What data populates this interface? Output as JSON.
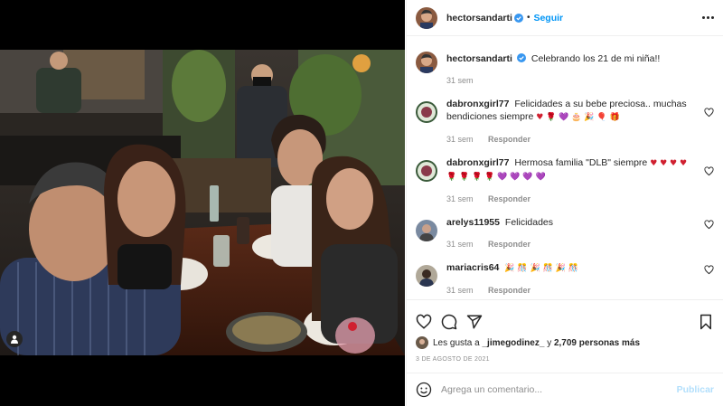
{
  "post": {
    "author": "hectorsandarti",
    "follow_label": "Seguir",
    "separator": "•",
    "caption": "Celebrando los 21 de mi niña!!",
    "caption_time": "31 sem"
  },
  "comments": [
    {
      "user": "dabronxgirl77",
      "text": "Felicidades a su bebe preciosa.. muchas bendiciones siempre",
      "emojis": "♥ 🌹 💜 🎂 🎉 🎈 🎁",
      "time": "31 sem",
      "reply_label": "Responder"
    },
    {
      "user": "dabronxgirl77",
      "text": "Hermosa familia \"DLB\" siempre",
      "emojis": "♥ ♥ ♥ ♥ 🌹 🌹 🌹 🌹 💜 💜 💜 💜",
      "time": "31 sem",
      "reply_label": "Responder"
    },
    {
      "user": "arelys11955",
      "text": "Felicidades",
      "emojis": "",
      "time": "31 sem",
      "reply_label": "Responder"
    },
    {
      "user": "mariacris64",
      "text": "",
      "emojis": "🎉 🎊 🎉 🎊 🎉 🎊",
      "time": "31 sem",
      "reply_label": "Responder"
    }
  ],
  "likes": {
    "prefix": "Les gusta a",
    "liker": "_jimegodinez_",
    "middle": "y",
    "count": "2,709 personas más"
  },
  "date": "3 DE AGOSTO DE 2021",
  "add_comment": {
    "placeholder": "Agrega un comentario...",
    "publish_label": "Publicar"
  },
  "icons": {
    "like": "heart-icon",
    "comment": "comment-icon",
    "share": "share-icon",
    "save": "bookmark-icon",
    "emoji": "emoji-icon",
    "tag": "user-tag-icon",
    "verified": "verified-badge-icon"
  },
  "colors": {
    "accent": "#0095f6",
    "verified": "#3897f0",
    "muted": "#8e8e8e",
    "publish_disabled": "#b2dffc"
  }
}
